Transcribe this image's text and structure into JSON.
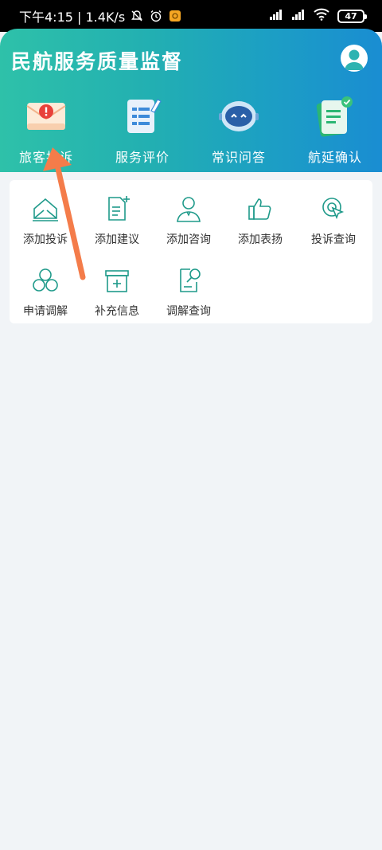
{
  "status_bar": {
    "time_speed": "下午4:15 | 1.4K/s",
    "battery": "47"
  },
  "header": {
    "title": "民航服务质量监督",
    "top_entries": [
      {
        "label": "旅客投诉",
        "icon": "complaint-envelope-icon"
      },
      {
        "label": "服务评价",
        "icon": "service-review-icon"
      },
      {
        "label": "常识问答",
        "icon": "robot-qa-icon"
      },
      {
        "label": "航延确认",
        "icon": "delay-confirm-icon"
      }
    ]
  },
  "grid": {
    "items": [
      {
        "label": "添加投诉",
        "icon": "envelope-add-icon"
      },
      {
        "label": "添加建议",
        "icon": "doc-add-icon"
      },
      {
        "label": "添加咨询",
        "icon": "user-consult-icon"
      },
      {
        "label": "添加表扬",
        "icon": "thumbs-up-icon"
      },
      {
        "label": "投诉查询",
        "icon": "search-cursor-icon"
      },
      {
        "label": "申请调解",
        "icon": "mediation-icon"
      },
      {
        "label": "补充信息",
        "icon": "box-add-icon"
      },
      {
        "label": "调解查询",
        "icon": "doc-search-icon"
      }
    ]
  },
  "colors": {
    "accent": "#1f9a8a",
    "header_start": "#2ec1a9",
    "header_end": "#1a8dd2",
    "arrow": "#f47c4a"
  }
}
